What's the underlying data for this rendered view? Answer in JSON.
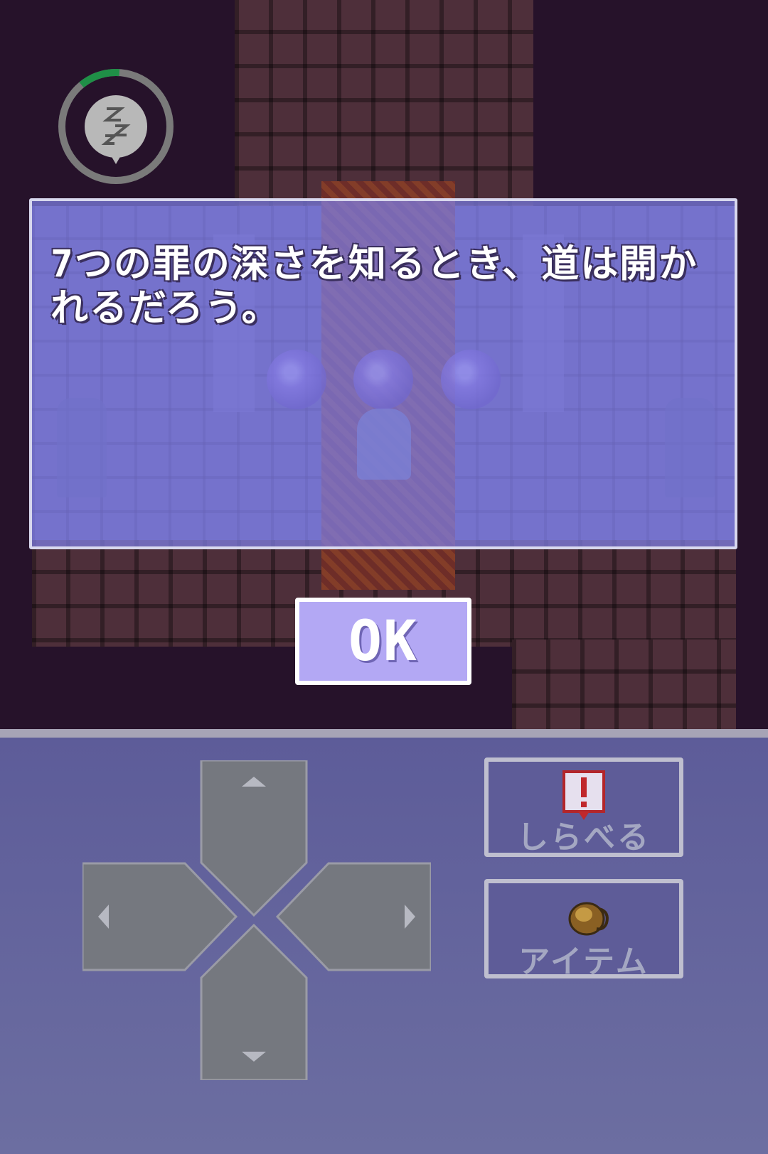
{
  "message": {
    "text": "7つの罪の深さを知るとき、道は開かれるだろう。"
  },
  "ok_button": {
    "label": "OK"
  },
  "controls": {
    "inspect_label": "しらべる",
    "item_label": "アイテム",
    "inspect_icon": "exclamation-sign-icon",
    "item_icon": "leather-pouch-icon"
  },
  "sleep_timer": {
    "icon": "zzz-sleep-icon",
    "progress": 0.12
  },
  "colors": {
    "timer_fill": "#1f8f47",
    "timer_track": "#7a7a7a",
    "message_bg": "#8080e8",
    "ok_bg": "#b3a8f4",
    "panel_bg": "#62619c",
    "dpad": "#75787f"
  }
}
